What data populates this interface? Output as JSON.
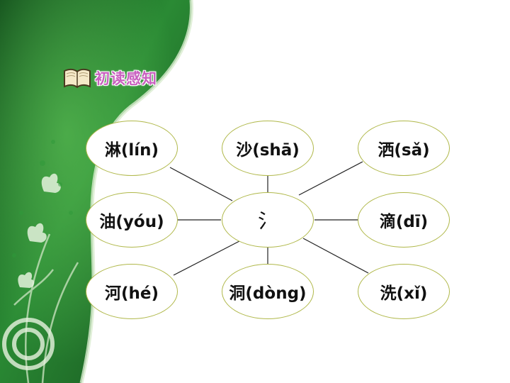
{
  "section": {
    "title": "初读感知",
    "icon": "book-icon"
  },
  "diagram": {
    "center": "氵",
    "words": [
      "淋(lín)",
      "沙(shā)",
      "洒(sǎ)",
      "油(yóu)",
      "滴(dī)",
      "河(hé)",
      "洞(dòng)",
      "洗(xǐ)"
    ]
  },
  "colors": {
    "node_border": "#b0b84a",
    "title_text": "#c85fbf",
    "background_green": "#1e6b27",
    "connector": "#222222"
  }
}
